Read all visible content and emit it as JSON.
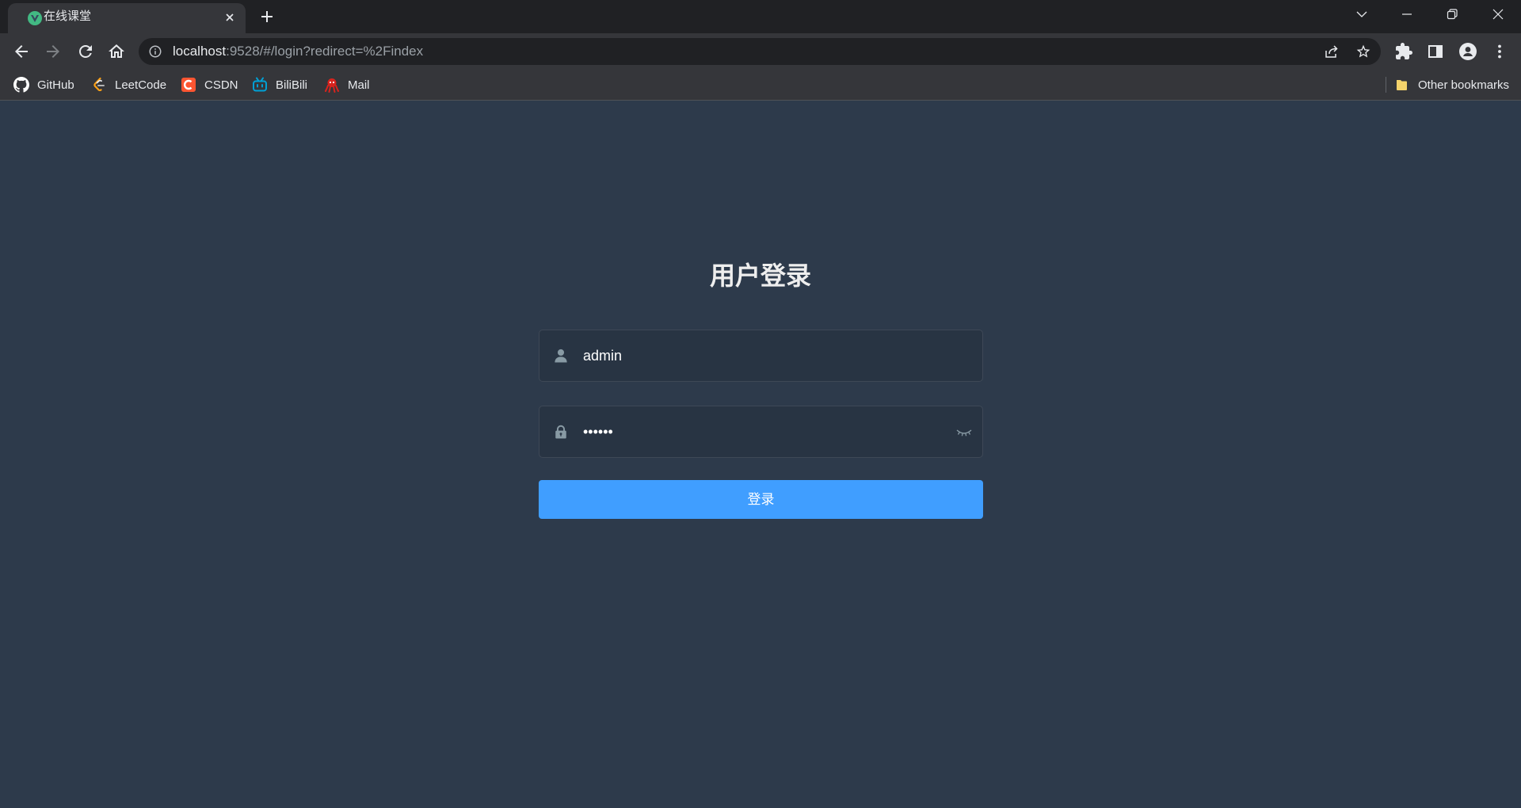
{
  "window": {
    "tab_title": "在线课堂",
    "tab_favicon": "vue-logo-icon"
  },
  "toolbar": {
    "url_host": "localhost",
    "url_rest": ":9528/#/login?redirect=%2Findex"
  },
  "bookmarks": {
    "items": [
      {
        "label": "GitHub",
        "icon": "github-icon"
      },
      {
        "label": "LeetCode",
        "icon": "leetcode-icon"
      },
      {
        "label": "CSDN",
        "icon": "csdn-icon"
      },
      {
        "label": "BiliBili",
        "icon": "bilibili-icon"
      },
      {
        "label": "Mail",
        "icon": "mail-icon"
      }
    ],
    "other": "Other bookmarks",
    "other_icon": "folder-icon"
  },
  "login": {
    "title": "用户登录",
    "username_value": "admin",
    "username_icon": "user-icon",
    "password_value": "••••••",
    "password_icon": "lock-icon",
    "password_toggle_icon": "eye-closed-icon",
    "submit_label": "登录"
  },
  "colors": {
    "page_background": "#2d3a4b",
    "primary_button": "#409eff",
    "title_text": "#eeeeee",
    "input_text": "#ffffff",
    "input_icon": "#889aa4",
    "browser_frame": "#202124",
    "browser_toolbar": "#35363a"
  }
}
